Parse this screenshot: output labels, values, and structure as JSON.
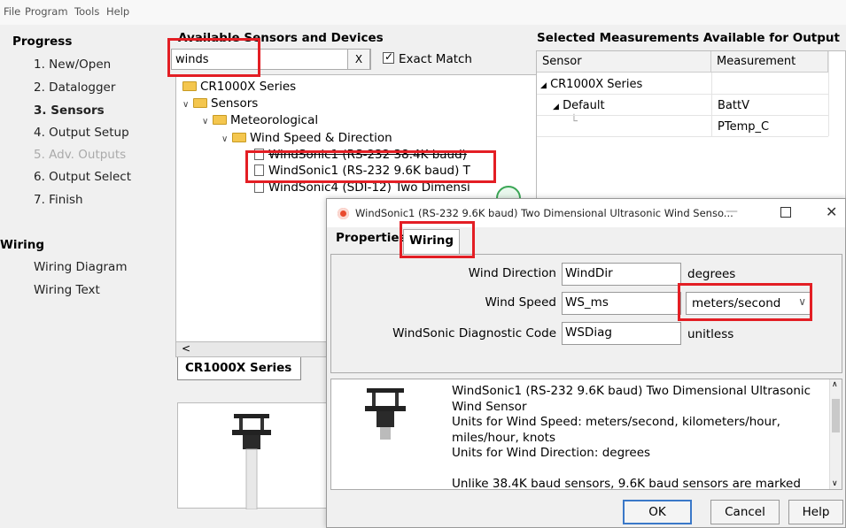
{
  "menu": [
    "File",
    "Program",
    "Tools",
    "Help"
  ],
  "progress": {
    "heading": "Progress",
    "steps": [
      "1. New/Open",
      "2. Datalogger",
      "3. Sensors",
      "4. Output Setup",
      "5. Adv. Outputs",
      "6. Output Select",
      "7. Finish"
    ],
    "active_step": "3. Sensors",
    "disabled_step": "5. Adv. Outputs"
  },
  "wiring": {
    "heading": "Wiring",
    "items": [
      "Wiring Diagram",
      "Wiring Text"
    ]
  },
  "sensors": {
    "title": "Available Sensors and Devices",
    "search_value": "winds",
    "clear_label": "X",
    "exact_match_label": "Exact Match",
    "exact_match_checked": true,
    "tree": {
      "root": "CR1000X Series",
      "sensors": "Sensors",
      "meteorological": "Meteorological",
      "wind": "Wind Speed & Direction",
      "item1": "WindSonic1 (RS-232 38.4K baud)",
      "item2": "WindSonic1 (RS-232 9.6K baud) T",
      "item3": "WindSonic4 (SDI-12) Two Dimensi"
    },
    "tab_label": "CR1000X Series"
  },
  "outputs": {
    "title": "Selected Measurements Available for Output",
    "col_sensor": "Sensor",
    "col_measurement": "Measurement",
    "root": "CR1000X Series",
    "group": "Default",
    "m1": "BattV",
    "m2": "PTemp_C"
  },
  "dialog": {
    "title": "WindSonic1 (RS-232 9.6K baud) Two Dimensional Ultrasonic Wind Senso...",
    "tab_properties": "Properties",
    "tab_wiring": "Wiring",
    "fields": {
      "wind_direction_label": "Wind Direction",
      "wind_direction_value": "WindDir",
      "wind_direction_unit": "degrees",
      "wind_speed_label": "Wind Speed",
      "wind_speed_value": "WS_ms",
      "wind_speed_unit": "meters/second",
      "diag_label": "WindSonic Diagnostic Code",
      "diag_value": "WSDiag",
      "diag_unit": "unitless"
    },
    "description": {
      "line1": "WindSonic1 (RS-232 9.6K baud) Two Dimensional Ultrasonic",
      "line2": "Wind Sensor",
      "line3": "Units for Wind Speed: meters/second, kilometers/hour,",
      "line4": "miles/hour, knots",
      "line5": "Units for Wind Direction: degrees",
      "line6": "",
      "line7": "Unlike 38.4K baud sensors, 9.6K baud sensors are marked"
    },
    "buttons": {
      "ok": "OK",
      "cancel": "Cancel",
      "help": "Help"
    }
  },
  "colors": {
    "highlight": "#e31e24",
    "folder": "#f4c64e"
  }
}
